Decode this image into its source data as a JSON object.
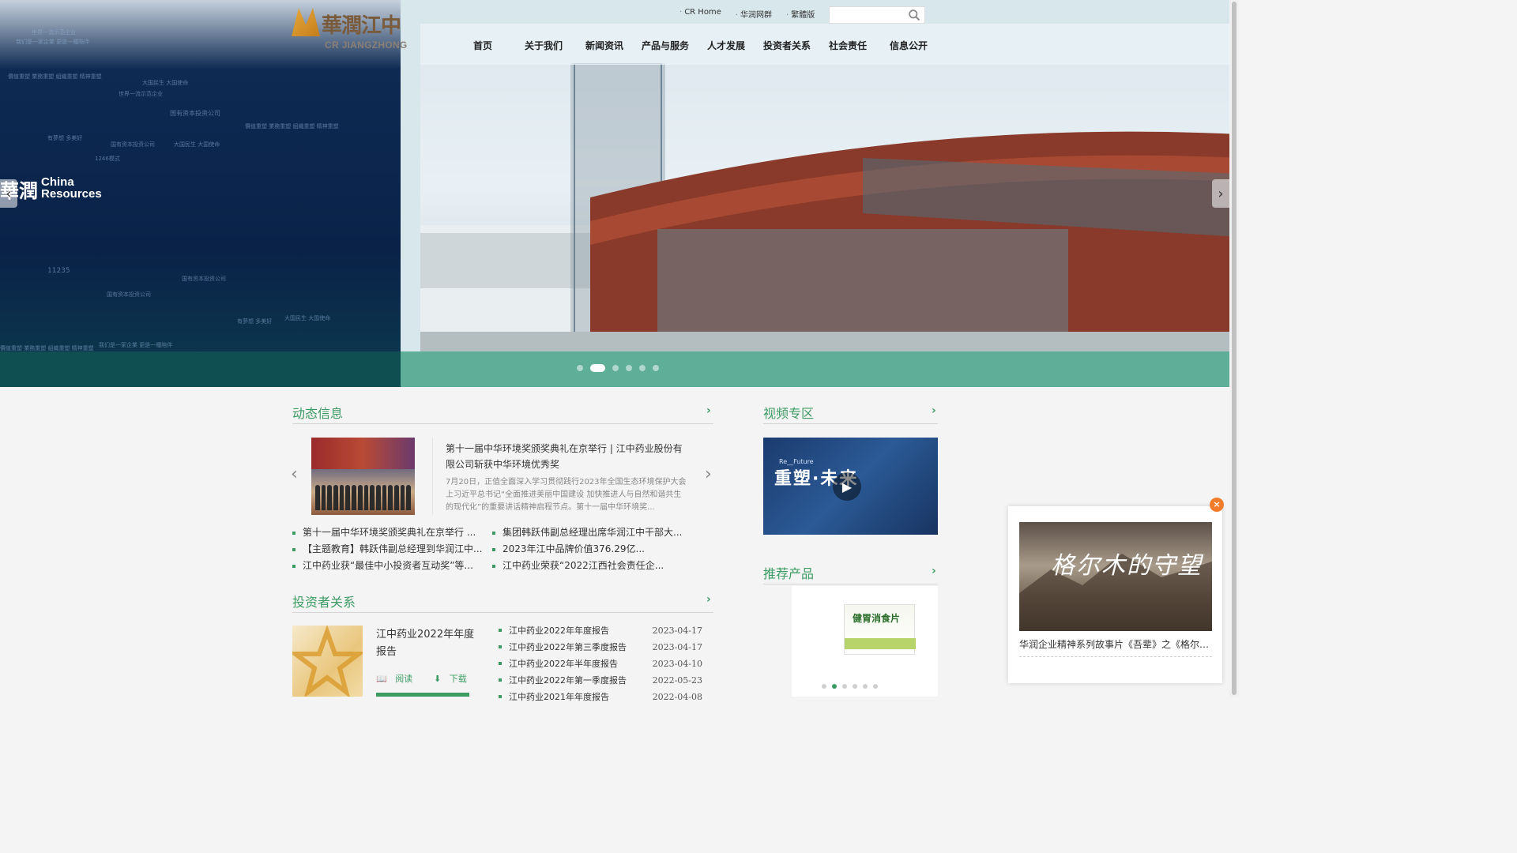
{
  "header": {
    "logo_zh": "華潤江中",
    "logo_en": "CR JIANGZHONG",
    "top_links": [
      "CR Home",
      "华润网群",
      "繁體版"
    ],
    "search_placeholder": ""
  },
  "nav": [
    "首页",
    "关于我们",
    "新闻资讯",
    "产品与服务",
    "人才发展",
    "投资者关系",
    "社会责任",
    "信息公开"
  ],
  "hero": {
    "brand_zh": "華潤",
    "brand_en_1": "China",
    "brand_en_2": "Resources",
    "slide_count": 6,
    "active_slide": 2,
    "banner_texts": [
      "世界一流示范企业",
      "国有资本投资公司",
      "有夢想 多美好",
      "大国民生 大国使命",
      "我们是一家企業 更是一種陪伴",
      "價值重塑 業務重塑 組織重塑 精神重塑",
      "1246模式",
      "11235"
    ]
  },
  "news": {
    "title": "动态信息",
    "featured_title": "第十一届中华环境奖颁奖典礼在京举行 | 江中药业股份有限公司斩获中华环境优秀奖",
    "featured_desc": "7月20日，正值全面深入学习贯彻践行2023年全国生态环境保护大会上习近平总书记“全面推进美丽中国建设 加快推进人与自然和谐共生的现代化”的重要讲话精神启程节点。第十一届中华环境奖...",
    "list_left": [
      "第十一届中华环境奖颁奖典礼在京举行 ...",
      "【主题教育】韩跃伟副总经理到华润江中...",
      "江中药业获“最佳中小投资者互动奖”等..."
    ],
    "list_right": [
      "集团韩跃伟副总经理出席华润江中干部大...",
      "2023年江中品牌价值376.29亿...",
      "江中药业荣获“2022江西社会责任企..."
    ]
  },
  "investor": {
    "title": "投资者关系",
    "featured": "江中药业2022年年度报告",
    "read_label": "阅读",
    "download_label": "下载",
    "reports": [
      {
        "name": "江中药业2022年年度报告",
        "date": "2023-04-17"
      },
      {
        "name": "江中药业2022年第三季度报告",
        "date": "2023-04-17"
      },
      {
        "name": "江中药业2022年半年度报告",
        "date": "2023-04-10"
      },
      {
        "name": "江中药业2022年第一季度报告",
        "date": "2022-05-23"
      },
      {
        "name": "江中药业2021年年度报告",
        "date": "2022-04-08"
      }
    ]
  },
  "video": {
    "title": "视频专区",
    "caption_small": "Re__Future",
    "caption_big": "重塑·未来"
  },
  "products": {
    "title": "推荐产品",
    "product_label": "健胃消食片",
    "dot_count": 6,
    "active_dot": 2
  },
  "popup": {
    "image_text": "格尔木的守望",
    "caption": "华润企业精神系列故事片《吾辈》之《格尔木的守望》",
    "close": "×"
  },
  "colors": {
    "accent": "#3c9b63",
    "band": "#5fae97",
    "close": "#f07c2c"
  }
}
